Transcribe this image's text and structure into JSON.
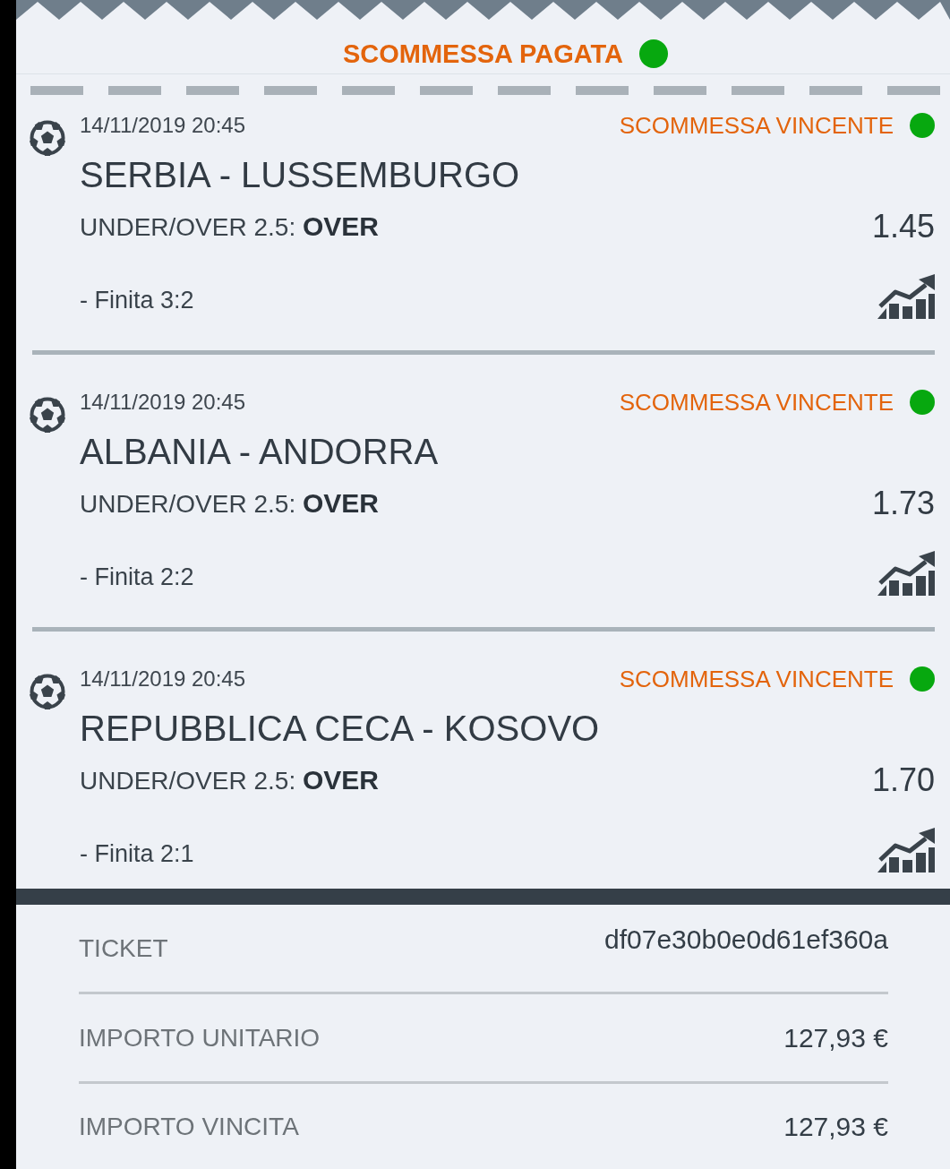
{
  "header": {
    "title": "SCOMMESSA PAGATA"
  },
  "bets": [
    {
      "date": "14/11/2019 20:45",
      "status": "SCOMMESSA VINCENTE",
      "match": "SERBIA - LUSSEMBURGO",
      "market": "UNDER/OVER 2.5: **OVER**",
      "odds": "1.45",
      "result": "- Finita 3:2"
    },
    {
      "date": "14/11/2019 20:45",
      "status": "SCOMMESSA VINCENTE",
      "match": "ALBANIA - ANDORRA",
      "market": "UNDER/OVER 2.5: **OVER**",
      "odds": "1.73",
      "result": "- Finita 2:2"
    },
    {
      "date": "14/11/2019 20:45",
      "status": "SCOMMESSA VINCENTE",
      "match": "REPUBBLICA CECA - KOSOVO",
      "market": "UNDER/OVER 2.5: **OVER**",
      "odds": "1.70",
      "result": "- Finita 2:1"
    }
  ],
  "summary": [
    {
      "label": "TICKET",
      "value": "df07e30b0e0d61ef360a"
    },
    {
      "label": "IMPORTO UNITARIO",
      "value": "127,93 €"
    },
    {
      "label": "IMPORTO VINCITA",
      "value": "127,93 €"
    }
  ]
}
